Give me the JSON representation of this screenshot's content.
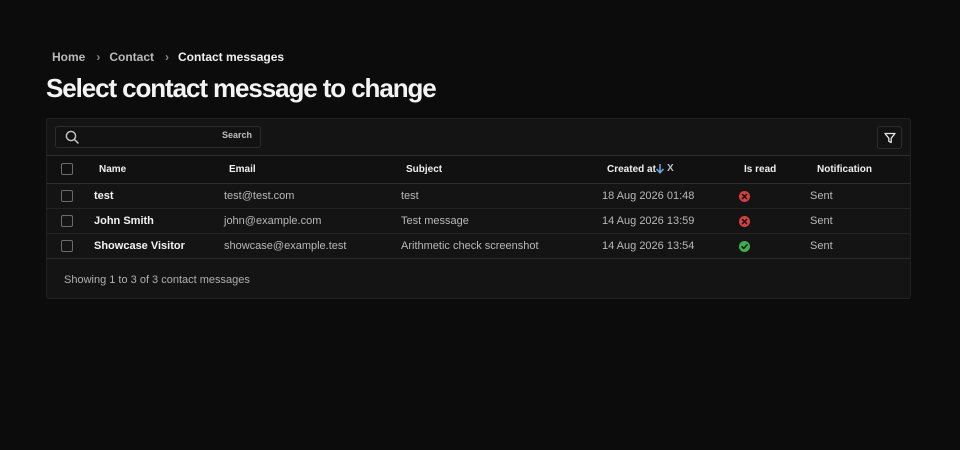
{
  "breadcrumb": {
    "home": "Home",
    "section": "Contact",
    "current": "Contact messages",
    "separator": "›"
  },
  "page_title": "Select contact message to change",
  "search": {
    "placeholder": "",
    "value": "",
    "button_label": "Search"
  },
  "filter_icon": "filter-funnel-icon",
  "columns": {
    "name": "Name",
    "email": "Email",
    "subject": "Subject",
    "created_at": "Created at",
    "is_read": "Is read",
    "notification": "Notification"
  },
  "sort": {
    "direction": "descending",
    "remove_label": "X"
  },
  "rows": [
    {
      "name": "test",
      "email": "test@test.com",
      "subject": "test",
      "created_at": "18 Aug 2026 01:48",
      "is_read": false,
      "notification": "Sent"
    },
    {
      "name": "John Smith",
      "email": "john@example.com",
      "subject": "Test message",
      "created_at": "14 Aug 2026 13:59",
      "is_read": false,
      "notification": "Sent"
    },
    {
      "name": "Showcase Visitor",
      "email": "showcase@example.test",
      "subject": "Arithmetic check screenshot",
      "created_at": "14 Aug 2026 13:54",
      "is_read": true,
      "notification": "Sent"
    }
  ],
  "footer": "Showing 1 to 3 of 3 contact messages",
  "colors": {
    "background": "#0c0c0c",
    "read_true": "#3fae4d",
    "read_false": "#d64040",
    "sort_arrow": "#6ea8e6"
  }
}
